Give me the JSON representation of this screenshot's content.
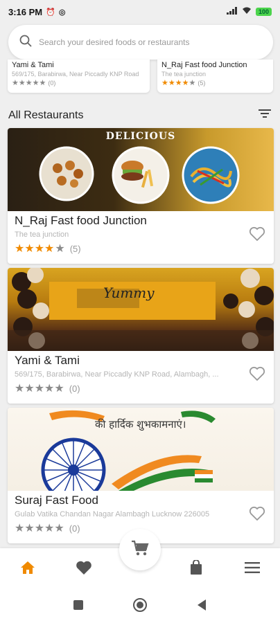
{
  "status_bar": {
    "time": "3:16 PM",
    "battery": "100"
  },
  "search": {
    "placeholder": "Search your desired foods or restaurants"
  },
  "featured": [
    {
      "name": "Yami & Tami",
      "address": "569/175, Barabirwa, Near Piccadly KNP Road",
      "rating": 0,
      "count": "(0)"
    },
    {
      "name": "N_Raj Fast food Junction",
      "address": "The tea junction",
      "rating": 4,
      "count": "(5)"
    }
  ],
  "section": {
    "title": "All Restaurants"
  },
  "restaurants": [
    {
      "name": "N_Raj Fast food Junction",
      "address": "The tea junction",
      "rating": 4,
      "count": "(5)",
      "banner_text": "DELICIOUS"
    },
    {
      "name": "Yami & Tami",
      "address": "569/175, Barabirwa, Near Piccadly KNP Road, Alambagh, ...",
      "rating": 0,
      "count": "(0)",
      "banner_text": "Yummy"
    },
    {
      "name": "Suraj Fast Food",
      "address": "Gulab Vatika Chandan Nagar Alambagh Lucknow 226005",
      "rating": 0,
      "count": "(0)",
      "banner_text": "की हार्दिक शुभकामनाएं।"
    }
  ],
  "nav": [
    "home-icon",
    "heart-icon",
    "cart-icon",
    "bag-icon",
    "menu-icon"
  ],
  "colors": {
    "accent": "#f08a00",
    "background": "#efefef"
  }
}
